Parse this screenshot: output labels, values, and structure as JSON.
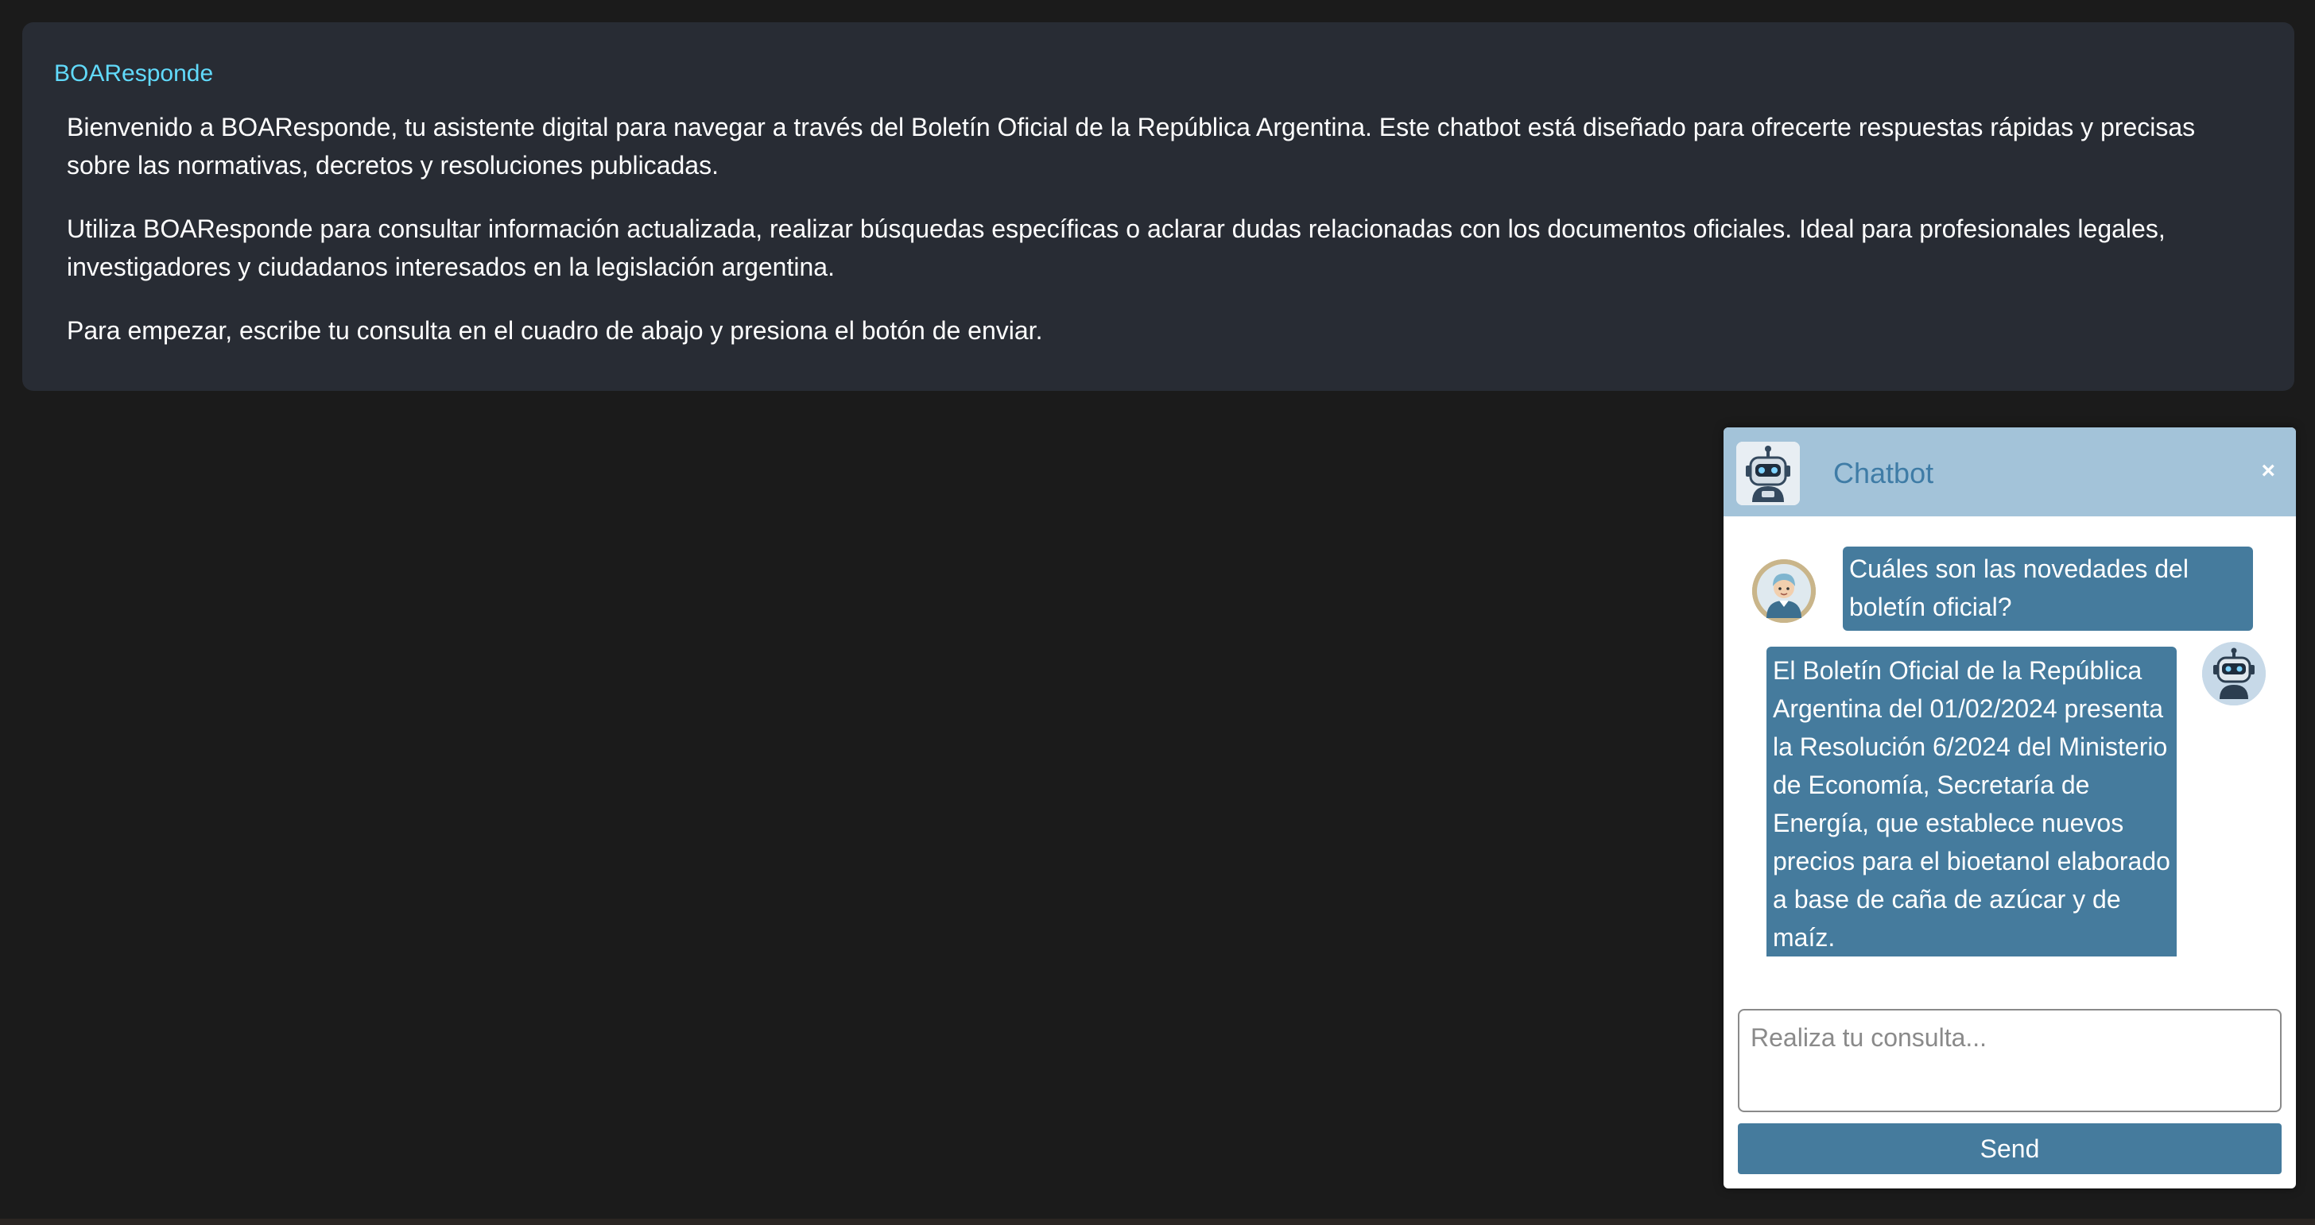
{
  "intro": {
    "title": "BOAResponde",
    "paragraphs": [
      "Bienvenido a BOAResponde, tu asistente digital para navegar a través del Boletín Oficial de la República Argentina. Este chatbot está diseñado para ofrecerte respuestas rápidas y precisas sobre las normativas, decretos y resoluciones publicadas.",
      "Utiliza BOAResponde para consultar información actualizada, realizar búsquedas específicas o aclarar dudas relacionadas con los documentos oficiales. Ideal para profesionales legales, investigadores y ciudadanos interesados en la legislación argentina.",
      "Para empezar, escribe tu consulta en el cuadro de abajo y presiona el botón de enviar."
    ]
  },
  "chat": {
    "title": "Chatbot",
    "close_label": "×",
    "header_icon": "robot-icon",
    "messages": [
      {
        "sender": "user",
        "avatar_icon": "user-avatar-icon",
        "text": "Cuáles son las novedades del boletín oficial?"
      },
      {
        "sender": "bot",
        "avatar_icon": "robot-icon",
        "text": "El Boletín Oficial de la República Argentina del 01/02/2024 presenta la Resolución 6/2024 del Ministerio de Economía, Secretaría de Energía, que establece nuevos precios para el bioetanol elaborado a base de caña de azúcar y de maíz."
      }
    ],
    "input": {
      "placeholder": "Realiza tu consulta...",
      "value": ""
    },
    "send_label": "Send"
  },
  "colors": {
    "page_background": "#1b1b1b",
    "card_background": "#282c34",
    "title_accent": "#61dafb",
    "chat_header": "#a3c3d9",
    "chat_title": "#3f7ca6",
    "bubble": "#457b9d",
    "send_button": "#457b9d"
  }
}
